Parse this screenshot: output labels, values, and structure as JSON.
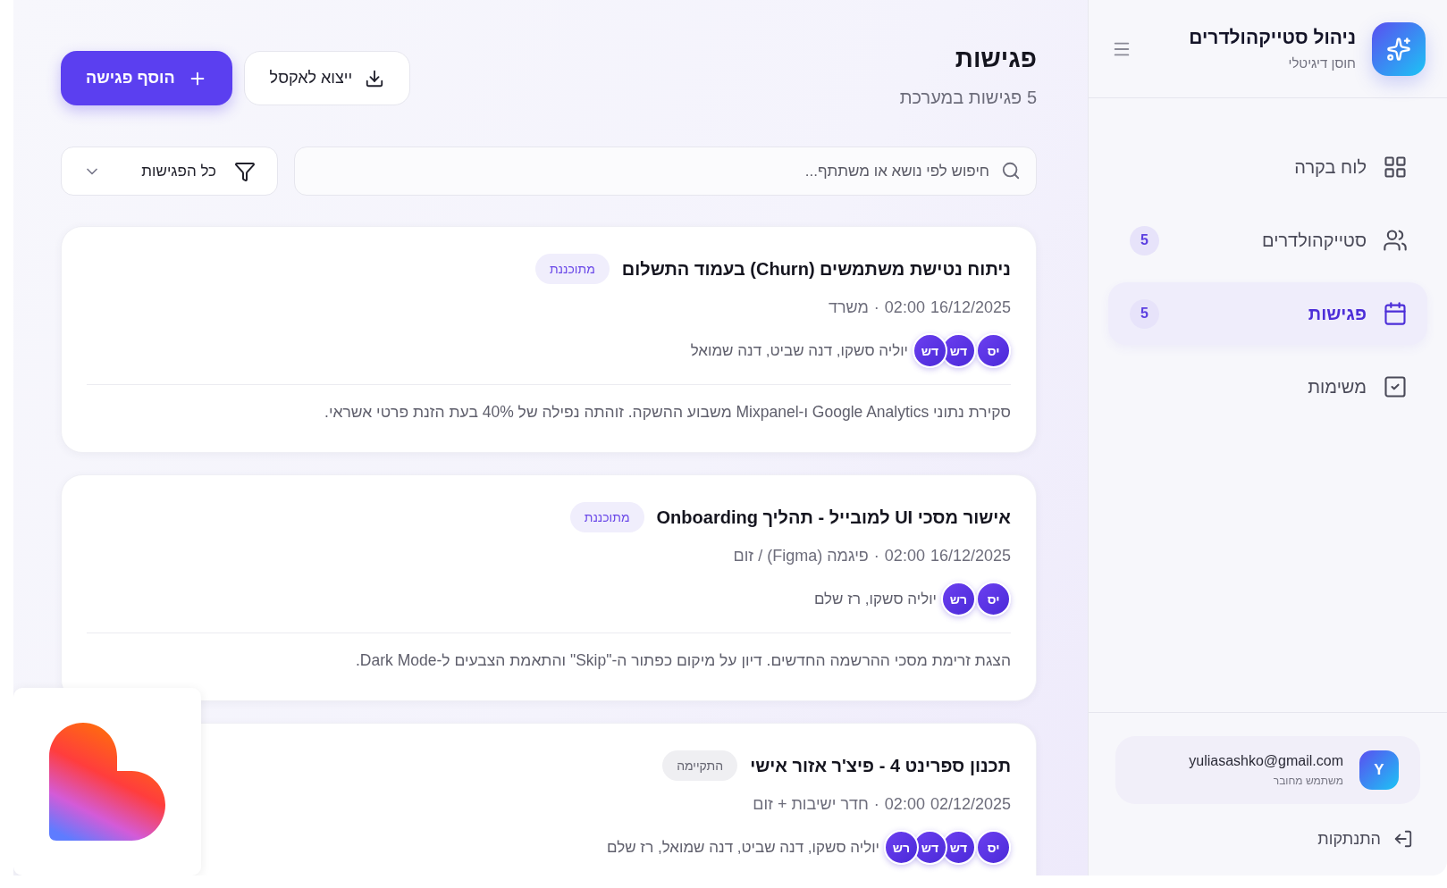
{
  "sidebar": {
    "app_title": "ניהול סטייקהולדרים",
    "app_subtitle": "חוסן דיגיטלי",
    "nav": [
      {
        "label": "לוח בקרה",
        "selected": false
      },
      {
        "label": "סטייקהולדרים",
        "count": "5",
        "selected": false
      },
      {
        "label": "פגישות",
        "count": "5",
        "selected": true
      },
      {
        "label": "משימות",
        "selected": false
      }
    ],
    "user": {
      "initial": "Y",
      "email": "yuliasashko@gmail.com",
      "role": "משתמש מחובר"
    },
    "logout": "התנתקות"
  },
  "page": {
    "title": "פגישות",
    "subtitle": "5 פגישות במערכת",
    "export_button": "ייצוא לאקסל",
    "add_button": "הוסף פגישה",
    "search": {
      "placeholder": "חיפוש לפי נושא או משתתף..."
    },
    "filter": {
      "value": "כל הפגישות"
    }
  },
  "meetings": [
    {
      "title": "ניתוח נטישת משתמשים (Churn) בעמוד התשלום",
      "status": {
        "label": "מתוכננת",
        "kind": "planned"
      },
      "date": "16/12/2025",
      "time": "02:00",
      "separator": "·",
      "location": "משרד",
      "avatars": [
        "יס",
        "דש",
        "דש"
      ],
      "participants": "יוליה סשקו, דנה שביט, דנה שמואל",
      "description": "סקירת נתוני Google Analytics ו-Mixpanel משבוע ההשקה. זוהתה נפילה של 40% בעת הזנת פרטי אשראי."
    },
    {
      "title": "אישור מסכי UI למובייל - תהליך Onboarding",
      "status": {
        "label": "מתוכננת",
        "kind": "planned"
      },
      "date": "16/12/2025",
      "time": "02:00",
      "separator": "·",
      "location": "פיגמה (Figma) / זום",
      "avatars": [
        "יס",
        "רש"
      ],
      "participants": "יוליה סשקו, רז שלם",
      "description": "הצגת זרימת מסכי ההרשמה החדשים. דיון על מיקום כפתור ה-\"Skip\" והתאמת הצבעים ל-Dark Mode."
    },
    {
      "title": "תכנון ספרינט 4 - פיצ'ר אזור אישי",
      "status": {
        "label": "התקיימה",
        "kind": "done"
      },
      "date": "02/12/2025",
      "time": "02:00",
      "separator": "·",
      "location": "חדר ישיבות + זום",
      "avatars": [
        "יס",
        "דש",
        "דש",
        "רש"
      ],
      "participants": "יוליה סשקו, דנה שביט, דנה שמואל, רז שלם"
    }
  ],
  "overlay": {
    "kind": "logo-card"
  }
}
